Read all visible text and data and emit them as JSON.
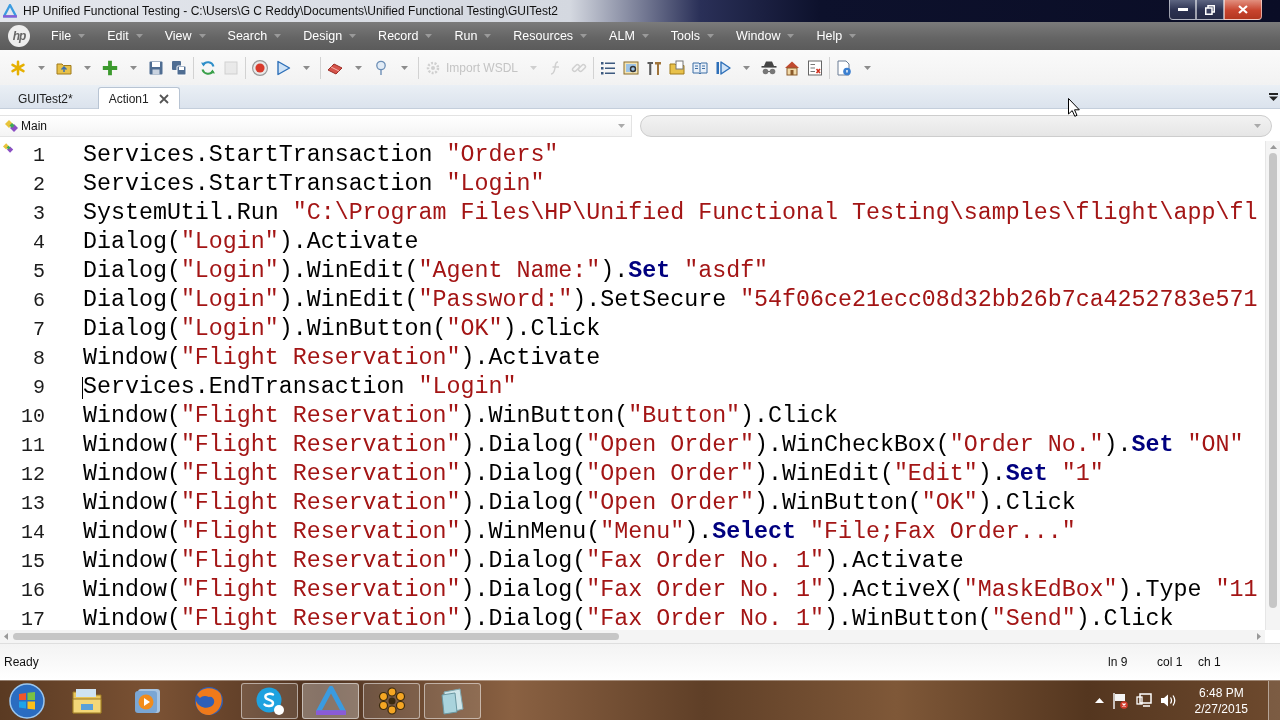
{
  "window": {
    "title": "HP Unified Functional Testing - C:\\Users\\G C Reddy\\Documents\\Unified Functional Testing\\GUITest2"
  },
  "menu_bar": {
    "logo": "hp",
    "items": [
      "File",
      "Edit",
      "View",
      "Search",
      "Design",
      "Record",
      "Run",
      "Resources",
      "ALM",
      "Tools",
      "Window",
      "Help"
    ]
  },
  "toolbar": {
    "items": [
      {
        "kind": "button",
        "dropdown": true,
        "disabled": false
      },
      {
        "kind": "button",
        "dropdown": true,
        "disabled": false
      },
      {
        "kind": "button",
        "dropdown": true,
        "disabled": false
      },
      {
        "kind": "button",
        "dropdown": false,
        "disabled": false
      },
      {
        "kind": "button",
        "dropdown": false,
        "disabled": false
      },
      {
        "kind": "separator"
      },
      {
        "kind": "button",
        "dropdown": false,
        "disabled": false
      },
      {
        "kind": "button",
        "dropdown": false,
        "disabled": true
      },
      {
        "kind": "separator"
      },
      {
        "kind": "button",
        "dropdown": false,
        "disabled": false
      },
      {
        "kind": "button",
        "dropdown": true,
        "disabled": false
      },
      {
        "kind": "separator"
      },
      {
        "kind": "button",
        "dropdown": true,
        "disabled": false
      },
      {
        "kind": "button",
        "dropdown": true,
        "disabled": false
      },
      {
        "kind": "separator"
      },
      {
        "kind": "button",
        "label": "Import WSDL",
        "dropdown": true,
        "disabled": true
      },
      {
        "kind": "button",
        "dropdown": false,
        "disabled": true
      },
      {
        "kind": "button",
        "dropdown": false,
        "disabled": true
      },
      {
        "kind": "separator"
      },
      {
        "kind": "button",
        "dropdown": false,
        "disabled": false
      },
      {
        "kind": "button",
        "dropdown": false,
        "disabled": false
      },
      {
        "kind": "button",
        "dropdown": false,
        "disabled": false
      },
      {
        "kind": "button",
        "dropdown": false,
        "disabled": false
      },
      {
        "kind": "button",
        "dropdown": false,
        "disabled": false
      },
      {
        "kind": "button",
        "dropdown": true,
        "disabled": false
      },
      {
        "kind": "button",
        "dropdown": false,
        "disabled": false
      },
      {
        "kind": "button",
        "dropdown": false,
        "disabled": false
      },
      {
        "kind": "button",
        "dropdown": false,
        "disabled": false
      },
      {
        "kind": "separator"
      },
      {
        "kind": "button",
        "dropdown": true,
        "disabled": false
      }
    ]
  },
  "tabs": [
    {
      "label": "GUITest2*",
      "selected": false,
      "closable": false
    },
    {
      "label": "Action1",
      "selected": true,
      "closable": true
    }
  ],
  "action_combo": {
    "value": "Main"
  },
  "editor": {
    "lines": [
      {
        "number": "1",
        "cursor": false,
        "tokens": [
          {
            "kind": "plain",
            "text": "Services.StartTransaction "
          },
          {
            "kind": "string",
            "text": "\"Orders\""
          }
        ]
      },
      {
        "number": "2",
        "cursor": false,
        "tokens": [
          {
            "kind": "plain",
            "text": "Services.StartTransaction "
          },
          {
            "kind": "string",
            "text": "\"Login\""
          }
        ]
      },
      {
        "number": "3",
        "cursor": false,
        "tokens": [
          {
            "kind": "plain",
            "text": "SystemUtil.Run "
          },
          {
            "kind": "string",
            "text": "\"C:\\Program Files\\HP\\Unified Functional Testing\\samples\\flight\\app\\fl"
          }
        ]
      },
      {
        "number": "4",
        "cursor": false,
        "tokens": [
          {
            "kind": "plain",
            "text": "Dialog("
          },
          {
            "kind": "string",
            "text": "\"Login\""
          },
          {
            "kind": "plain",
            "text": ").Activate"
          }
        ]
      },
      {
        "number": "5",
        "cursor": false,
        "tokens": [
          {
            "kind": "plain",
            "text": "Dialog("
          },
          {
            "kind": "string",
            "text": "\"Login\""
          },
          {
            "kind": "plain",
            "text": ").WinEdit("
          },
          {
            "kind": "string",
            "text": "\"Agent Name:\""
          },
          {
            "kind": "plain",
            "text": ")."
          },
          {
            "kind": "keyword",
            "text": "Set"
          },
          {
            "kind": "string",
            "text": " \"asdf\""
          }
        ]
      },
      {
        "number": "6",
        "cursor": false,
        "tokens": [
          {
            "kind": "plain",
            "text": "Dialog("
          },
          {
            "kind": "string",
            "text": "\"Login\""
          },
          {
            "kind": "plain",
            "text": ").WinEdit("
          },
          {
            "kind": "string",
            "text": "\"Password:\""
          },
          {
            "kind": "plain",
            "text": ").SetSecure "
          },
          {
            "kind": "string",
            "text": "\"54f06ce21ecc08d32bb26b7ca4252783e571"
          }
        ]
      },
      {
        "number": "7",
        "cursor": false,
        "tokens": [
          {
            "kind": "plain",
            "text": "Dialog("
          },
          {
            "kind": "string",
            "text": "\"Login\""
          },
          {
            "kind": "plain",
            "text": ").WinButton("
          },
          {
            "kind": "string",
            "text": "\"OK\""
          },
          {
            "kind": "plain",
            "text": ").Click"
          }
        ]
      },
      {
        "number": "8",
        "cursor": false,
        "tokens": [
          {
            "kind": "plain",
            "text": "Window("
          },
          {
            "kind": "string",
            "text": "\"Flight Reservation\""
          },
          {
            "kind": "plain",
            "text": ").Activate"
          }
        ]
      },
      {
        "number": "9",
        "cursor": true,
        "tokens": [
          {
            "kind": "plain",
            "text": "Services.EndTransaction "
          },
          {
            "kind": "string",
            "text": "\"Login\""
          }
        ]
      },
      {
        "number": "10",
        "cursor": false,
        "tokens": [
          {
            "kind": "plain",
            "text": "Window("
          },
          {
            "kind": "string",
            "text": "\"Flight Reservation\""
          },
          {
            "kind": "plain",
            "text": ").WinButton("
          },
          {
            "kind": "string",
            "text": "\"Button\""
          },
          {
            "kind": "plain",
            "text": ").Click"
          }
        ]
      },
      {
        "number": "11",
        "cursor": false,
        "tokens": [
          {
            "kind": "plain",
            "text": "Window("
          },
          {
            "kind": "string",
            "text": "\"Flight Reservation\""
          },
          {
            "kind": "plain",
            "text": ").Dialog("
          },
          {
            "kind": "string",
            "text": "\"Open Order\""
          },
          {
            "kind": "plain",
            "text": ").WinCheckBox("
          },
          {
            "kind": "string",
            "text": "\"Order No.\""
          },
          {
            "kind": "plain",
            "text": ")."
          },
          {
            "kind": "keyword",
            "text": "Set"
          },
          {
            "kind": "string",
            "text": " \"ON\""
          }
        ]
      },
      {
        "number": "12",
        "cursor": false,
        "tokens": [
          {
            "kind": "plain",
            "text": "Window("
          },
          {
            "kind": "string",
            "text": "\"Flight Reservation\""
          },
          {
            "kind": "plain",
            "text": ").Dialog("
          },
          {
            "kind": "string",
            "text": "\"Open Order\""
          },
          {
            "kind": "plain",
            "text": ").WinEdit("
          },
          {
            "kind": "string",
            "text": "\"Edit\""
          },
          {
            "kind": "plain",
            "text": ")."
          },
          {
            "kind": "keyword",
            "text": "Set"
          },
          {
            "kind": "string",
            "text": " \"1\""
          }
        ]
      },
      {
        "number": "13",
        "cursor": false,
        "tokens": [
          {
            "kind": "plain",
            "text": "Window("
          },
          {
            "kind": "string",
            "text": "\"Flight Reservation\""
          },
          {
            "kind": "plain",
            "text": ").Dialog("
          },
          {
            "kind": "string",
            "text": "\"Open Order\""
          },
          {
            "kind": "plain",
            "text": ").WinButton("
          },
          {
            "kind": "string",
            "text": "\"OK\""
          },
          {
            "kind": "plain",
            "text": ").Click"
          }
        ]
      },
      {
        "number": "14",
        "cursor": false,
        "tokens": [
          {
            "kind": "plain",
            "text": "Window("
          },
          {
            "kind": "string",
            "text": "\"Flight Reservation\""
          },
          {
            "kind": "plain",
            "text": ").WinMenu("
          },
          {
            "kind": "string",
            "text": "\"Menu\""
          },
          {
            "kind": "plain",
            "text": ")."
          },
          {
            "kind": "keyword",
            "text": "Select"
          },
          {
            "kind": "string",
            "text": " \"File;Fax Order...\""
          }
        ]
      },
      {
        "number": "15",
        "cursor": false,
        "tokens": [
          {
            "kind": "plain",
            "text": "Window("
          },
          {
            "kind": "string",
            "text": "\"Flight Reservation\""
          },
          {
            "kind": "plain",
            "text": ").Dialog("
          },
          {
            "kind": "string",
            "text": "\"Fax Order No. 1\""
          },
          {
            "kind": "plain",
            "text": ").Activate"
          }
        ]
      },
      {
        "number": "16",
        "cursor": false,
        "tokens": [
          {
            "kind": "plain",
            "text": "Window("
          },
          {
            "kind": "string",
            "text": "\"Flight Reservation\""
          },
          {
            "kind": "plain",
            "text": ").Dialog("
          },
          {
            "kind": "string",
            "text": "\"Fax Order No. 1\""
          },
          {
            "kind": "plain",
            "text": ").ActiveX("
          },
          {
            "kind": "string",
            "text": "\"MaskEdBox\""
          },
          {
            "kind": "plain",
            "text": ").Type "
          },
          {
            "kind": "string",
            "text": "\"11"
          }
        ]
      },
      {
        "number": "17",
        "cursor": false,
        "tokens": [
          {
            "kind": "plain",
            "text": "Window("
          },
          {
            "kind": "string",
            "text": "\"Flight Reservation\""
          },
          {
            "kind": "plain",
            "text": ").Dialog("
          },
          {
            "kind": "string",
            "text": "\"Fax Order No. 1\""
          },
          {
            "kind": "plain",
            "text": ").WinButton("
          },
          {
            "kind": "string",
            "text": "\"Send\""
          },
          {
            "kind": "plain",
            "text": ").Click"
          }
        ]
      }
    ]
  },
  "status_bar": {
    "message": "Ready",
    "line": "ln 9",
    "column": "col 1",
    "char": "ch 1"
  },
  "taskbar": {
    "apps": [
      {
        "running": false,
        "selected": false
      },
      {
        "running": false,
        "selected": false
      },
      {
        "running": false,
        "selected": false
      },
      {
        "running": true,
        "selected": false
      },
      {
        "running": true,
        "selected": true
      },
      {
        "running": true,
        "selected": false
      },
      {
        "running": true,
        "selected": false
      }
    ],
    "clock": {
      "time": "6:48 PM",
      "date": "2/27/2015"
    }
  }
}
